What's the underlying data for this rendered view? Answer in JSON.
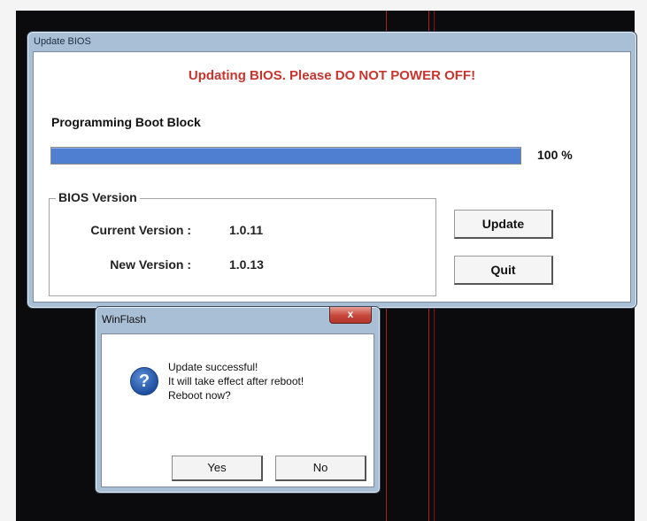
{
  "bios_window": {
    "title": "Update BIOS",
    "warning": "Updating BIOS. Please DO NOT POWER OFF!",
    "operation": "Programming  Boot  Block",
    "progress_value": 100,
    "progress_text": "100 %",
    "group_title": "BIOS Version",
    "current_version_label": "Current Version :",
    "current_version_value": "1.0.11",
    "new_version_label": "New Version :",
    "new_version_value": "1.0.13",
    "update_button": "Update",
    "quit_button": "Quit"
  },
  "dialog": {
    "title": "WinFlash",
    "close_glyph": "x",
    "icon_glyph": "?",
    "message_line1": "Update successful!",
    "message_line2": "It will take effect after reboot!",
    "message_line3": "Reboot now?",
    "yes_button": "Yes",
    "no_button": "No"
  },
  "colors": {
    "warning_red": "#c8352f",
    "progress_blue": "#4f7fd0",
    "window_frame": "#a9bfd6"
  }
}
